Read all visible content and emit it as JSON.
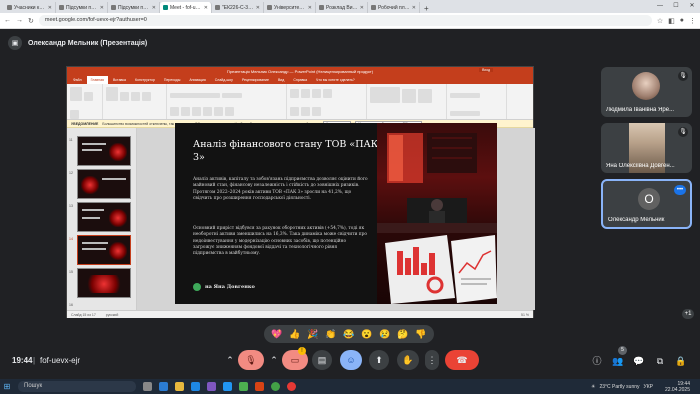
{
  "browser": {
    "tabs": [
      {
        "label": "Учасники курсу \"ЕК226-",
        "active": false
      },
      {
        "label": "Підсумки практики",
        "active": false
      },
      {
        "label": "Підсумки практики",
        "active": false
      },
      {
        "label": "Meet - fof-uevx-ejr",
        "active": true
      },
      {
        "label": "\"ЕК226-С-3 Методи опти",
        "active": false
      },
      {
        "label": "Університет — Центральна",
        "active": false
      },
      {
        "label": "Розклад Викладача",
        "active": false
      },
      {
        "label": "Робочий план Спеціаль",
        "active": false
      }
    ],
    "url": "meet.google.com/fof-uevx-ejr?authuser=0"
  },
  "meet": {
    "presenter_title": "Олександр Мельник (Презентація)",
    "time": "19:44",
    "separator": "|",
    "meeting_code": "fof-uevx-ejr",
    "participants_count": "5",
    "overflow_count": "+1",
    "participants": [
      {
        "name": "Людмила Іванівна Яре..."
      },
      {
        "name": "Яна Олексіївна Довген..."
      },
      {
        "name": "Олександр Мельник",
        "initial": "О"
      }
    ],
    "reactions": [
      "💖",
      "👍",
      "🎉",
      "👏",
      "😂",
      "😮",
      "😢",
      "🤔",
      "👎"
    ]
  },
  "powerpoint": {
    "window_title": "Презентація Мельник Олександр — PowerPoint (Нелицензированный продукт)",
    "ribbon_tabs": [
      "Файл",
      "Главная",
      "Вставка",
      "Конструктор",
      "Переходы",
      "Анимация",
      "Слайд-шоу",
      "Рецензирование",
      "Вид",
      "Справка",
      "Что вы хотите сделать?"
    ],
    "selected_tab": "Главная",
    "notification_label": "УВЕДОМЛЕНИЕ",
    "notification_text": "Большинство возможностей отключены, так как продукт Office не лицензирован. Чтобы работать с этим продуктом, активируйте его.",
    "notify_btn1": "Активировать",
    "notify_btn2": "Использовать бесплатно в Office.com",
    "slide_counter": "Слайд 15 из 17",
    "language": "русский",
    "zoom": "51 %",
    "slide": {
      "title": "Аналіз фінансового стану ТОВ «ПАК 3»",
      "paragraph1": "Аналіз активів, капіталу та зобов'язань підприємства дозволяє оцінити його майновий стан, фінансову незалежність і стійкість до зовнішніх ризиків. Протягом 2022–2024 років активи ТОВ «ПАК 3» зросли на 41,2%, що свідчить про розширення господарської діяльності.",
      "paragraph2": "Основний приріст відбувся за рахунок оборотних активів (+54,7%), тоді як необоротні активи зменшились на 16,3%. Така динаміка може свідчити про недоінвестування у модернізацію основних засобів, що потенційно загрожує зниженням фондової віддачі та технологічного рівня підприємства в майбутньому.",
      "author": "на Яна Довгенко"
    },
    "thumbnails": [
      "11",
      "12",
      "13",
      "14",
      "15",
      "16"
    ]
  },
  "taskbar": {
    "search_placeholder": "Пошук",
    "weather": "23°C  Partly sunny",
    "lang": "УКР",
    "clock_time": "19:44",
    "clock_date": "22.04.2025"
  },
  "colors": {
    "ppt_red": "#c43e1c",
    "meet_bg": "#202124",
    "end_call": "#ea4335"
  }
}
